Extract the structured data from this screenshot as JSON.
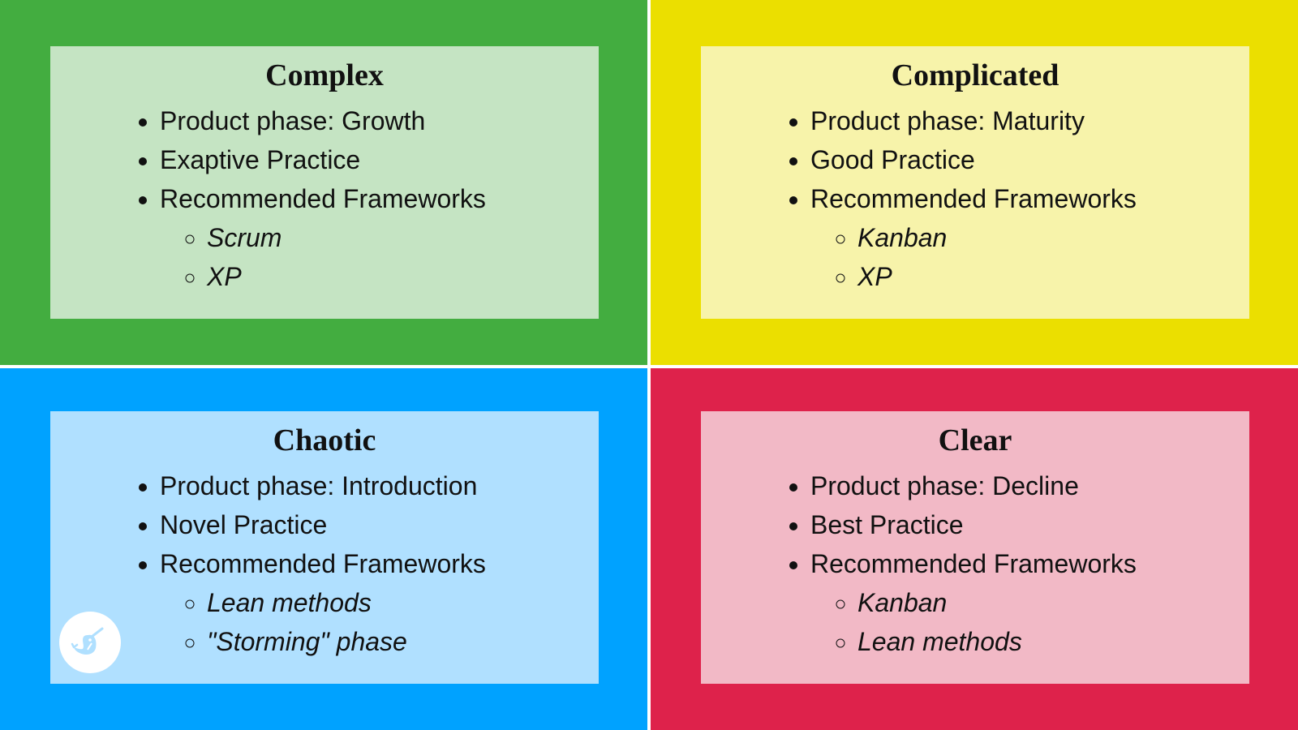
{
  "colors": {
    "complex_bg": "#43ad40",
    "complex_card": "#c5e4c3",
    "complicated_bg": "#ebdf00",
    "complicated_card": "#f7f3aa",
    "chaotic_bg": "#00a2ff",
    "chaotic_card": "#b0e0ff",
    "clear_bg": "#de224b",
    "clear_card": "#f2b9c6"
  },
  "quadrants": [
    {
      "title": "Complex",
      "items": [
        "Product phase: Growth",
        "Exaptive Practice",
        "Recommended Frameworks"
      ],
      "frameworks": [
        "Scrum",
        "XP"
      ]
    },
    {
      "title": "Complicated",
      "items": [
        "Product phase: Maturity",
        "Good Practice",
        "Recommended Frameworks"
      ],
      "frameworks": [
        "Kanban",
        "XP"
      ]
    },
    {
      "title": "Chaotic",
      "items": [
        "Product phase: Introduction",
        "Novel Practice",
        "Recommended Frameworks"
      ],
      "frameworks": [
        "Lean methods",
        "\"Storming\" phase"
      ]
    },
    {
      "title": "Clear",
      "items": [
        "Product phase: Decline",
        "Best Practice",
        "Recommended Frameworks"
      ],
      "frameworks": [
        "Kanban",
        "Lean methods"
      ]
    }
  ],
  "logo": {
    "icon": "narwhal-logo-icon"
  }
}
